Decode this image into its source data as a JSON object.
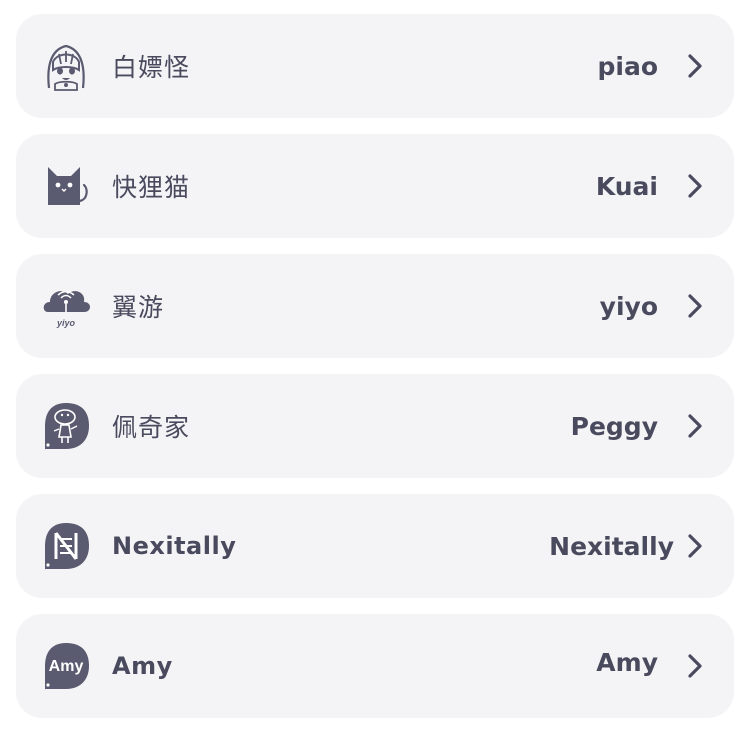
{
  "colors": {
    "row_background": "#f4f4f7",
    "text": "#4a4a5e",
    "icon": "#5a5a70"
  },
  "rows": [
    {
      "icon": "anime-girl-icon",
      "name": "白嫖怪",
      "value": "piao"
    },
    {
      "icon": "cat-icon",
      "name": "快狸猫",
      "value": "Kuai"
    },
    {
      "icon": "cloud-signal-icon",
      "icon_text": "yiyo",
      "name": "翼游",
      "value": "yiyo"
    },
    {
      "icon": "peppa-pig-icon",
      "name": "佩奇家",
      "value": "Peggy"
    },
    {
      "icon": "nexitally-logo-icon",
      "name": "Nexitally",
      "value": "Nexitally"
    },
    {
      "icon": "amy-logo-icon",
      "icon_text": "Amy",
      "name": "Amy",
      "value": "Amy"
    }
  ]
}
